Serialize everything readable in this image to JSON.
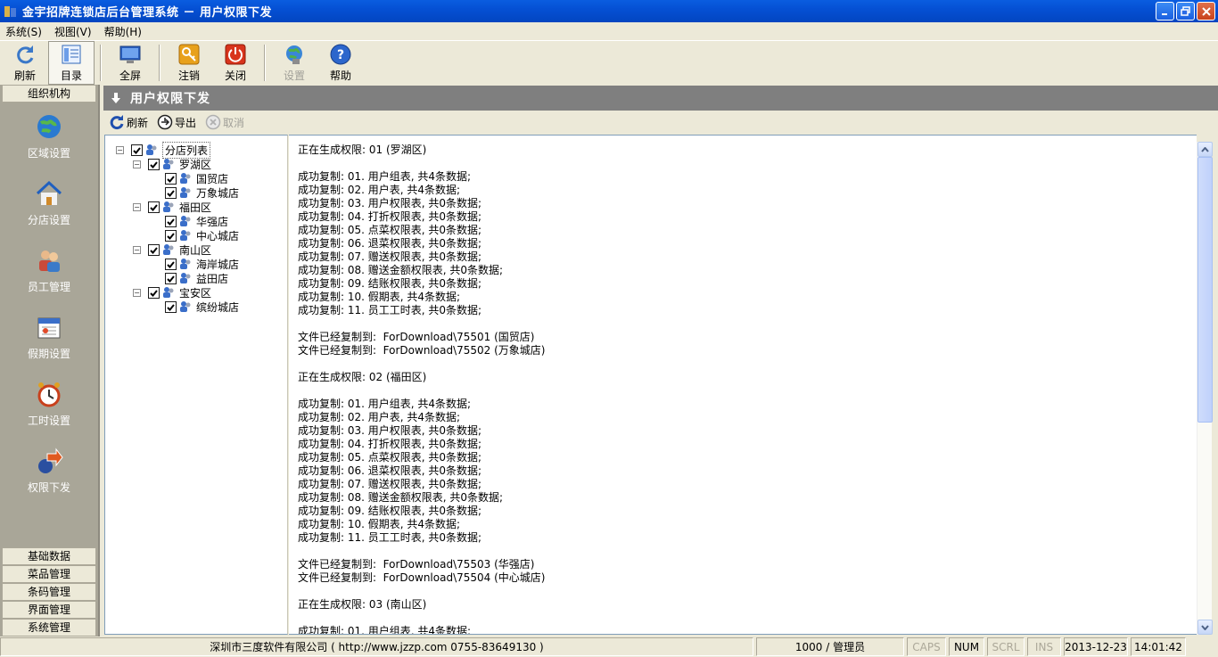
{
  "window": {
    "title": "金宇招牌连锁店后台管理系统 － 用户权限下发"
  },
  "menu": [
    "系统(S)",
    "视图(V)",
    "帮助(H)"
  ],
  "toolbar": {
    "refresh": "刷新",
    "directory": "目录",
    "fullscreen": "全屏",
    "logout": "注销",
    "close": "关闭",
    "settings": "设置",
    "help": "帮助"
  },
  "sidebar": {
    "header": "组织机构",
    "items": [
      "区域设置",
      "分店设置",
      "员工管理",
      "假期设置",
      "工时设置",
      "权限下发"
    ],
    "groups": [
      "基础数据",
      "菜品管理",
      "条码管理",
      "界面管理",
      "系统管理"
    ]
  },
  "panel": {
    "title": "用户权限下发",
    "refresh": "刷新",
    "export": "导出",
    "cancel": "取消"
  },
  "tree": {
    "root": "分店列表",
    "regions": [
      {
        "name": "罗湖区",
        "stores": [
          "国贸店",
          "万象城店"
        ]
      },
      {
        "name": "福田区",
        "stores": [
          "华强店",
          "中心城店"
        ]
      },
      {
        "name": "南山区",
        "stores": [
          "海岸城店",
          "益田店"
        ]
      },
      {
        "name": "宝安区",
        "stores": [
          "缤纷城店"
        ]
      }
    ]
  },
  "log": [
    "正在生成权限: 01 (罗湖区)",
    "",
    "成功复制: 01. 用户组表, 共4条数据;",
    "成功复制: 02. 用户表, 共4条数据;",
    "成功复制: 03. 用户权限表, 共0条数据;",
    "成功复制: 04. 打折权限表, 共0条数据;",
    "成功复制: 05. 点菜权限表, 共0条数据;",
    "成功复制: 06. 退菜权限表, 共0条数据;",
    "成功复制: 07. 赠送权限表, 共0条数据;",
    "成功复制: 08. 赠送金额权限表, 共0条数据;",
    "成功复制: 09. 结账权限表, 共0条数据;",
    "成功复制: 10. 假期表, 共4条数据;",
    "成功复制: 11. 员工工时表, 共0条数据;",
    "",
    "文件已经复制到:  ForDownload\\75501 (国贸店)",
    "文件已经复制到:  ForDownload\\75502 (万象城店)",
    "",
    "正在生成权限: 02 (福田区)",
    "",
    "成功复制: 01. 用户组表, 共4条数据;",
    "成功复制: 02. 用户表, 共4条数据;",
    "成功复制: 03. 用户权限表, 共0条数据;",
    "成功复制: 04. 打折权限表, 共0条数据;",
    "成功复制: 05. 点菜权限表, 共0条数据;",
    "成功复制: 06. 退菜权限表, 共0条数据;",
    "成功复制: 07. 赠送权限表, 共0条数据;",
    "成功复制: 08. 赠送金额权限表, 共0条数据;",
    "成功复制: 09. 结账权限表, 共0条数据;",
    "成功复制: 10. 假期表, 共4条数据;",
    "成功复制: 11. 员工工时表, 共0条数据;",
    "",
    "文件已经复制到:  ForDownload\\75503 (华强店)",
    "文件已经复制到:  ForDownload\\75504 (中心城店)",
    "",
    "正在生成权限: 03 (南山区)",
    "",
    "成功复制: 01. 用户组表, 共4条数据;"
  ],
  "status": {
    "company": "深圳市三度软件有限公司 ( http://www.jzzp.com  0755-83649130 )",
    "user": "1000 / 管理员",
    "caps": "CAPS",
    "num": "NUM",
    "scrl": "SCRL",
    "ins": "INS",
    "date": "2013-12-23",
    "time": "14:01:42"
  }
}
